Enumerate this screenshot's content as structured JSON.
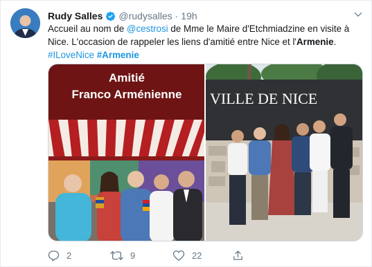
{
  "author": {
    "name": "Rudy Salles",
    "handle": "@rudysalles",
    "time": "19h",
    "verified": true
  },
  "tweet": {
    "line1_prefix": "Accueil au nom de ",
    "mention": "@cestrosi",
    "line1_suffix": " de Mme le Maire d'Etchmiadzine en visite à",
    "line2_prefix": "Nice. L'occasion de rappeler les liens d'amitié entre Nice et l'",
    "line2_bold": "Armenie",
    "line2_suffix": ".",
    "hashtag1": "#ILoveNice",
    "hashtag2": "#Armenie"
  },
  "media": {
    "left_banner_line1": "Amitié",
    "left_banner_line2": "Franco Arménienne",
    "right_sign_text": "VILLE DE NICE"
  },
  "actions": {
    "reply_count": "2",
    "retweet_count": "9",
    "like_count": "22"
  },
  "colors": {
    "link": "#1b95e0",
    "verified": "#1da1f2",
    "muted": "#657786"
  },
  "icons": [
    "verified-badge-icon",
    "chevron-down-icon",
    "reply-icon",
    "retweet-icon",
    "like-icon",
    "share-icon"
  ]
}
